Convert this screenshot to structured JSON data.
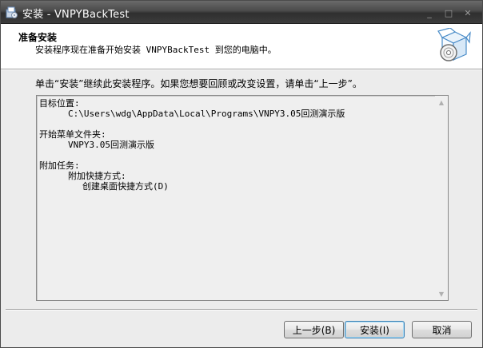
{
  "window": {
    "title": "安装 - VNPYBackTest",
    "controls": {
      "minimize": "_",
      "maximize": "□",
      "close": "✕"
    }
  },
  "header": {
    "title": "准备安装",
    "subtitle": "安装程序现在准备开始安装 VNPYBackTest 到您的电脑中。",
    "icon": "install-box-cd-icon"
  },
  "body": {
    "instruction": "单击“安装”继续此安装程序。如果您想要回顾或改变设置，请单击“上一步”。",
    "memo_lines": [
      {
        "text": "目标位置:",
        "indent": 0
      },
      {
        "text": "C:\\Users\\wdg\\AppData\\Local\\Programs\\VNPY3.05回测演示版",
        "indent": 1
      },
      {
        "text": "",
        "indent": 0
      },
      {
        "text": "开始菜单文件夹:",
        "indent": 0
      },
      {
        "text": "VNPY3.05回测演示版",
        "indent": 1
      },
      {
        "text": "",
        "indent": 0
      },
      {
        "text": "附加任务:",
        "indent": 0
      },
      {
        "text": "附加快捷方式:",
        "indent": 1
      },
      {
        "text": "创建桌面快捷方式(D)",
        "indent": 2
      }
    ]
  },
  "buttons": {
    "back": "上一步(B)",
    "install": "安装(I)",
    "cancel": "取消"
  }
}
